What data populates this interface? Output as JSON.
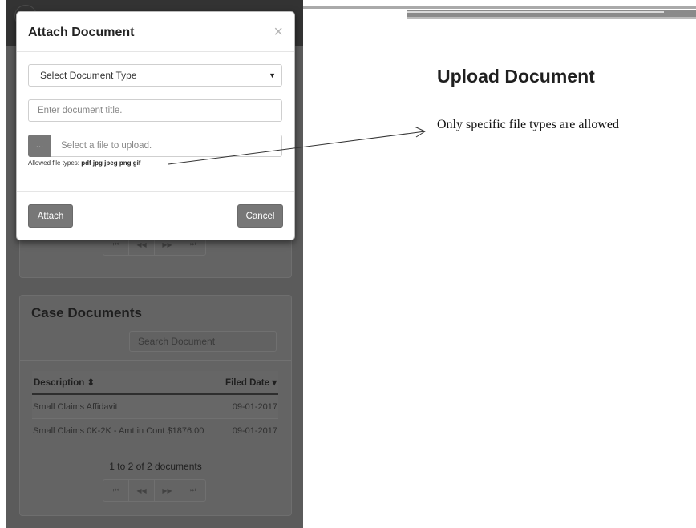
{
  "modal": {
    "title": "Attach Document",
    "close_glyph": "×",
    "document_type": {
      "selected": "Select Document Type",
      "arrow_glyph": "▼"
    },
    "title_input": {
      "placeholder": "Enter document title."
    },
    "file_upload": {
      "browse_label": "...",
      "placeholder": "Select a file to upload."
    },
    "allowed_types_label": "Allowed file types:",
    "allowed_types": "pdf jpg jpeg png gif",
    "attach_label": "Attach",
    "cancel_label": "Cancel"
  },
  "case_documents": {
    "title": "Case Documents",
    "search_placeholder": "Search Document",
    "columns": {
      "description": "Description",
      "description_sort": "⇕",
      "filed_date": "Filed Date",
      "filed_date_sort": "▾"
    },
    "rows": [
      {
        "description": "Small Claims Affidavit",
        "filed_date": "09-01-2017"
      },
      {
        "description": "Small Claims 0K-2K - Amt in Cont $1876.00",
        "filed_date": "09-01-2017"
      }
    ],
    "pager_summary": "1 to 2 of 2 documents"
  },
  "pager": {
    "first": "⏮",
    "prev": "◀◀",
    "next": "▶▶",
    "last": "⏭"
  },
  "annotation": {
    "title": "Upload Document",
    "text": "Only specific file types are allowed"
  },
  "colors": {
    "overlay_bg": "#5b5b5b",
    "button_gray": "#777777",
    "modal_bg": "#ffffff"
  }
}
